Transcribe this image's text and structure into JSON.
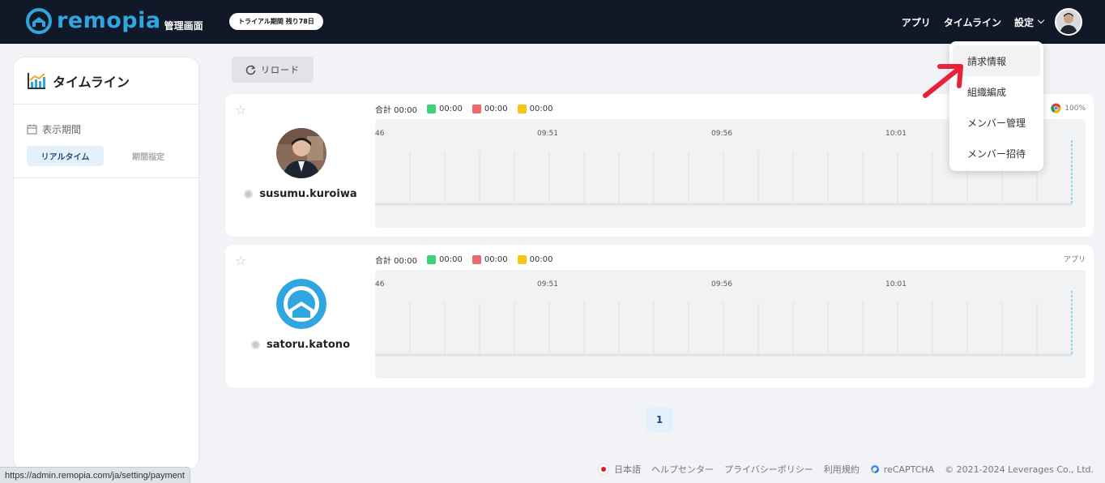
{
  "header": {
    "logo_text": "remopia",
    "logo_sub": "管理画面",
    "trial_badge": "トライアル期間 残り78日",
    "nav": {
      "app": "アプリ",
      "timeline": "タイムライン",
      "settings": "設定"
    }
  },
  "settings_menu": {
    "items": [
      {
        "label": "請求情報"
      },
      {
        "label": "組織編成"
      },
      {
        "label": "メンバー管理"
      },
      {
        "label": "メンバー招待"
      }
    ]
  },
  "sidebar": {
    "title": "タイムライン",
    "period_label": "表示期間",
    "tab_realtime": "リアルタイム",
    "tab_range": "期間指定"
  },
  "toolbar": {
    "reload_label": "リロード"
  },
  "members": [
    {
      "username": "susumu.kuroiwa",
      "total_label": "合計 00:00",
      "green": "00:00",
      "red": "00:00",
      "yellow": "00:00",
      "right_label": "100%",
      "times": [
        "46",
        "09:51",
        "09:56",
        "10:01"
      ]
    },
    {
      "username": "satoru.katono",
      "total_label": "合計 00:00",
      "green": "00:00",
      "red": "00:00",
      "yellow": "00:00",
      "right_label": "アプリ",
      "times": [
        "46",
        "09:51",
        "09:56",
        "10:01"
      ]
    }
  ],
  "pagination": {
    "current": "1"
  },
  "footer": {
    "language": "日本語",
    "help": "ヘルプセンター",
    "privacy": "プライバシーポリシー",
    "terms": "利用規約",
    "recaptcha": "reCAPTCHA",
    "copyright": "© 2021-2024 Leverages Co., Ltd."
  },
  "status_bar": {
    "url": "https://admin.remopia.com/ja/setting/payment"
  },
  "colors": {
    "header_bg": "#111827",
    "brand": "#2fa6e0",
    "legend_green": "#3fd17a",
    "legend_red": "#ee6a6a",
    "legend_yellow": "#f5c518",
    "arrow_red": "#e8203a"
  }
}
